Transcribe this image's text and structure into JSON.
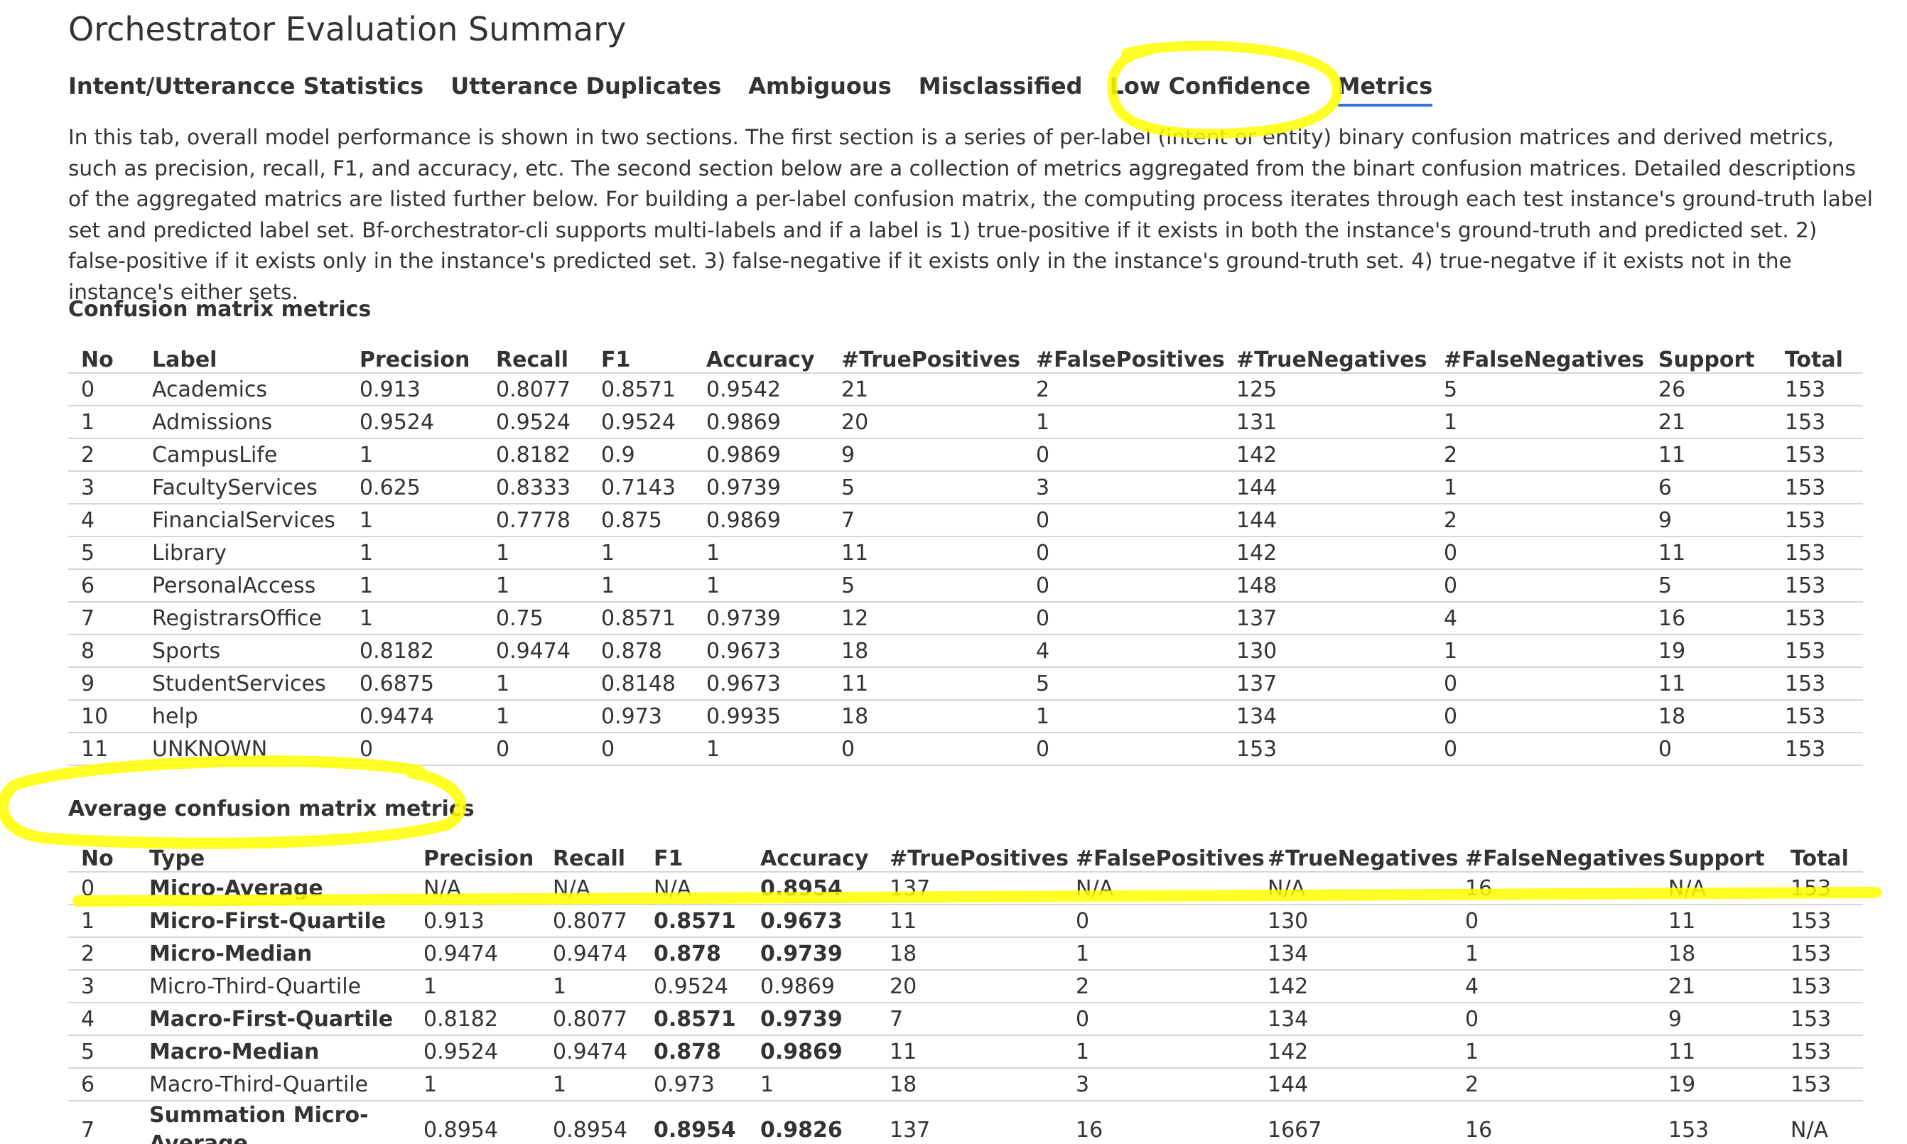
{
  "title": "Orchestrator Evaluation Summary",
  "tabs": [
    {
      "label": "Intent/Utterancce Statistics"
    },
    {
      "label": "Utterance Duplicates"
    },
    {
      "label": "Ambiguous"
    },
    {
      "label": "Misclassified"
    },
    {
      "label": "Low Confidence"
    },
    {
      "label": "Metrics"
    }
  ],
  "active_tab": "Metrics",
  "description": "In this tab, overall model performance is shown in two sections. The first section is a series of per-label (intent or entity) binary confusion matrices and derived metrics, such as precision, recall, F1, and accuracy, etc. The second section below are a collection of metrics aggregated from the binart confusion matrices. Detailed descriptions of the aggregated matrics are listed further below. For building a per-label confusion matrix, the computing process iterates through each test instance's ground-truth label set and predicted label set. Bf-orchestrator-cli supports multi-labels and if a label is 1) true-positive if it exists in both the instance's ground-truth and predicted set. 2) false-positive if it exists only in the instance's predicted set. 3) false-negative if it exists only in the instance's ground-truth set. 4) true-negatve if it exists not in the instance's either sets.",
  "confusion": {
    "heading": "Confusion matrix metrics",
    "columns": [
      "No",
      "Label",
      "Precision",
      "Recall",
      "F1",
      "Accuracy",
      "#TruePositives",
      "#FalsePositives",
      "#TrueNegatives",
      "#FalseNegatives",
      "Support",
      "Total"
    ],
    "rows": [
      [
        "0",
        "Academics",
        "0.913",
        "0.8077",
        "0.8571",
        "0.9542",
        "21",
        "2",
        "125",
        "5",
        "26",
        "153"
      ],
      [
        "1",
        "Admissions",
        "0.9524",
        "0.9524",
        "0.9524",
        "0.9869",
        "20",
        "1",
        "131",
        "1",
        "21",
        "153"
      ],
      [
        "2",
        "CampusLife",
        "1",
        "0.8182",
        "0.9",
        "0.9869",
        "9",
        "0",
        "142",
        "2",
        "11",
        "153"
      ],
      [
        "3",
        "FacultyServices",
        "0.625",
        "0.8333",
        "0.7143",
        "0.9739",
        "5",
        "3",
        "144",
        "1",
        "6",
        "153"
      ],
      [
        "4",
        "FinancialServices",
        "1",
        "0.7778",
        "0.875",
        "0.9869",
        "7",
        "0",
        "144",
        "2",
        "9",
        "153"
      ],
      [
        "5",
        "Library",
        "1",
        "1",
        "1",
        "1",
        "11",
        "0",
        "142",
        "0",
        "11",
        "153"
      ],
      [
        "6",
        "PersonalAccess",
        "1",
        "1",
        "1",
        "1",
        "5",
        "0",
        "148",
        "0",
        "5",
        "153"
      ],
      [
        "7",
        "RegistrarsOffice",
        "1",
        "0.75",
        "0.8571",
        "0.9739",
        "12",
        "0",
        "137",
        "4",
        "16",
        "153"
      ],
      [
        "8",
        "Sports",
        "0.8182",
        "0.9474",
        "0.878",
        "0.9673",
        "18",
        "4",
        "130",
        "1",
        "19",
        "153"
      ],
      [
        "9",
        "StudentServices",
        "0.6875",
        "1",
        "0.8148",
        "0.9673",
        "11",
        "5",
        "137",
        "0",
        "11",
        "153"
      ],
      [
        "10",
        "help",
        "0.9474",
        "1",
        "0.973",
        "0.9935",
        "18",
        "1",
        "134",
        "0",
        "18",
        "153"
      ],
      [
        "11",
        "UNKNOWN",
        "0",
        "0",
        "0",
        "1",
        "0",
        "0",
        "153",
        "0",
        "0",
        "153"
      ]
    ]
  },
  "average": {
    "heading": "Average confusion matrix metrics",
    "columns": [
      "No",
      "Type",
      "Precision",
      "Recall",
      "F1",
      "Accuracy",
      "#TruePositives",
      "#FalsePositives",
      "#TrueNegatives",
      "#FalseNegatives",
      "Support",
      "Total"
    ],
    "rows": [
      [
        "0",
        "Micro-Average",
        "N/A",
        "N/A",
        "N/A",
        "0.8954",
        "137",
        "N/A",
        "N/A",
        "16",
        "N/A",
        "153"
      ],
      [
        "1",
        "Micro-First-Quartile",
        "0.913",
        "0.8077",
        "0.8571",
        "0.9673",
        "11",
        "0",
        "130",
        "0",
        "11",
        "153"
      ],
      [
        "2",
        "Micro-Median",
        "0.9474",
        "0.9474",
        "0.878",
        "0.9739",
        "18",
        "1",
        "134",
        "1",
        "18",
        "153"
      ],
      [
        "3",
        "Micro-Third-Quartile",
        "1",
        "1",
        "0.9524",
        "0.9869",
        "20",
        "2",
        "142",
        "4",
        "21",
        "153"
      ],
      [
        "4",
        "Macro-First-Quartile",
        "0.8182",
        "0.8077",
        "0.8571",
        "0.9739",
        "7",
        "0",
        "134",
        "0",
        "9",
        "153"
      ],
      [
        "5",
        "Macro-Median",
        "0.9524",
        "0.9474",
        "0.878",
        "0.9869",
        "11",
        "1",
        "142",
        "1",
        "11",
        "153"
      ],
      [
        "6",
        "Macro-Third-Quartile",
        "1",
        "1",
        "0.973",
        "1",
        "18",
        "3",
        "144",
        "2",
        "19",
        "153"
      ],
      [
        "7",
        "Summation Micro-Average",
        "0.8954",
        "0.8954",
        "0.8954",
        "0.9826",
        "137",
        "16",
        "1667",
        "16",
        "153",
        "N/A"
      ]
    ],
    "bold_rows": [
      0,
      1,
      2,
      4,
      5,
      7
    ]
  },
  "colors": {
    "highlighter": "#ffff00",
    "tab_underline": "#2f74d0",
    "text": "#333333",
    "row_border": "#d6d6d6"
  }
}
